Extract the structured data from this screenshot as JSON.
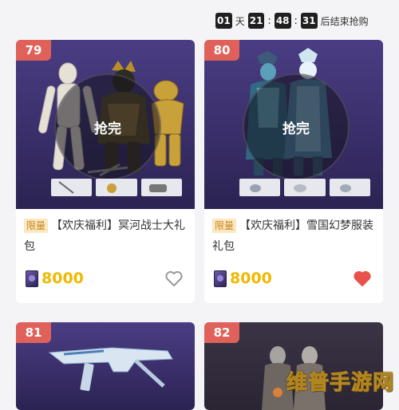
{
  "countdown": {
    "days": "01",
    "day_label": "天",
    "hours": "21",
    "sep1": ":",
    "minutes": "48",
    "sep2": ":",
    "seconds": "31",
    "suffix": "后结束抢购"
  },
  "cards": [
    {
      "number": "79",
      "sold_label": "抢完",
      "tag": "限量",
      "title": "【欢庆福利】冥河战士大礼包",
      "price": "8000",
      "favorited": false
    },
    {
      "number": "80",
      "sold_label": "抢完",
      "tag": "限量",
      "title": "【欢庆福利】雪国幻梦服装礼包",
      "price": "8000",
      "favorited": true
    },
    {
      "number": "81"
    },
    {
      "number": "82"
    }
  ],
  "colors": {
    "badge": "#e0615a",
    "price": "#f0b800",
    "heart_active": "#e8524a",
    "heart_inactive": "#999999",
    "tag_bg": "#fbe7c0",
    "tag_text": "#c8871f"
  },
  "watermark": "维普手游网"
}
